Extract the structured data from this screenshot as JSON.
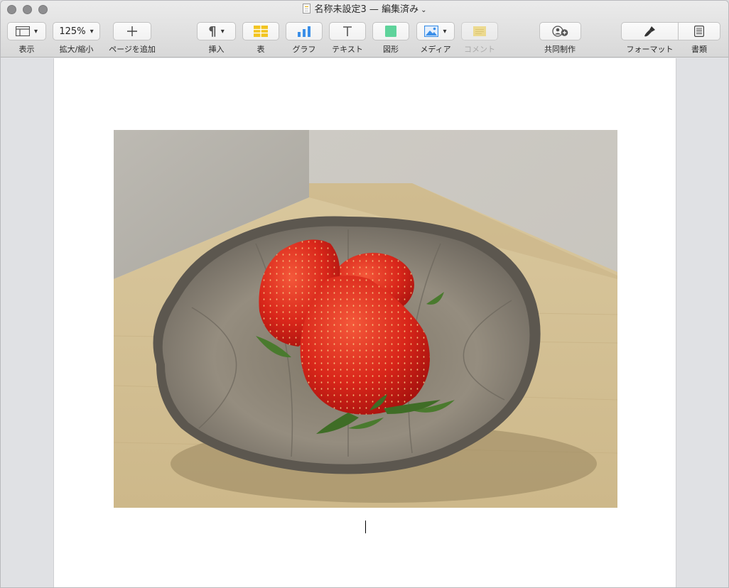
{
  "window": {
    "title": "名称未設定3 — 編集済み"
  },
  "toolbar": {
    "view": {
      "label": "表示"
    },
    "zoom": {
      "value": "125%",
      "label": "拡大/縮小"
    },
    "add_page": {
      "label": "ページを追加"
    },
    "insert": {
      "label": "挿入"
    },
    "table": {
      "label": "表"
    },
    "chart": {
      "label": "グラフ"
    },
    "text": {
      "label": "テキスト"
    },
    "shape": {
      "label": "図形"
    },
    "media": {
      "label": "メディア"
    },
    "comment": {
      "label": "コメント",
      "enabled": false
    },
    "collaborate": {
      "label": "共同制作"
    },
    "format": {
      "label": "フォーマット"
    },
    "document": {
      "label": "書類"
    }
  },
  "document": {
    "image": {
      "subject": "strawberries-in-bowl"
    }
  },
  "colors": {
    "table_icon": "#f2c522",
    "chart_icon": "#3b8fe8",
    "shape_icon": "#5ed39b",
    "media_icon": "#3b8fe8",
    "comment_icon": "#f4d65b"
  }
}
